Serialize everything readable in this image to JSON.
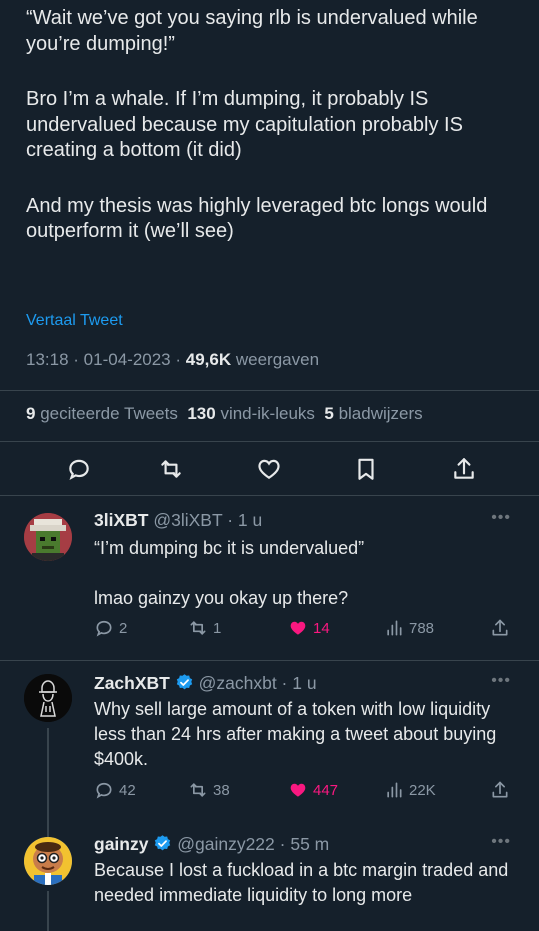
{
  "tweet": {
    "paragraphs": [
      "“Wait we’ve got you saying rlb is undervalued while you’re dumping!”",
      "Bro I’m a whale. If I’m dumping, it probably IS undervalued because my capitulation probably IS creating a bottom (it did)",
      "And my thesis was highly leveraged btc longs would outperform it (we’ll see)"
    ],
    "translate_label": "Vertaal Tweet",
    "time": "13:18",
    "date": "01-04-2023",
    "views_count": "49,6K",
    "views_label": "weergaven",
    "stats": {
      "quotes_count": "9",
      "quotes_label": "geciteerde Tweets",
      "likes_count": "130",
      "likes_label": "vind-ik-leuks",
      "bookmarks_count": "5",
      "bookmarks_label": "bladwijzers"
    }
  },
  "colors": {
    "background": "#15202b",
    "text": "#e7e9ea",
    "muted": "#8b98a5",
    "accent": "#1d9bf0",
    "like": "#f91880"
  },
  "replies": [
    {
      "name": "3liXBT",
      "handle": "@3liXBT",
      "time": "1 u",
      "verified": false,
      "paragraphs": [
        "“I’m dumping bc it is undervalued”",
        "lmao gainzy you okay up there?"
      ],
      "replies": "2",
      "retweets": "1",
      "likes": "14",
      "liked": true,
      "views": "788",
      "avatar_icon": "pixel-art-avatar"
    },
    {
      "name": "ZachXBT",
      "handle": "@zachxbt",
      "time": "1 u",
      "verified": true,
      "paragraphs": [
        "Why sell large amount of a token with low liquidity less than 24 hrs after making a tweet about buying $400k."
      ],
      "replies": "42",
      "retweets": "38",
      "likes": "447",
      "liked": true,
      "views": "22K",
      "avatar_icon": "detective-sketch-avatar"
    },
    {
      "name": "gainzy",
      "handle": "@gainzy222",
      "time": "55 m",
      "verified": true,
      "paragraphs": [
        "Because I lost a fuckload in a btc margin traded and needed immediate liquidity to long more"
      ],
      "avatar_icon": "cartoon-man-avatar"
    }
  ]
}
